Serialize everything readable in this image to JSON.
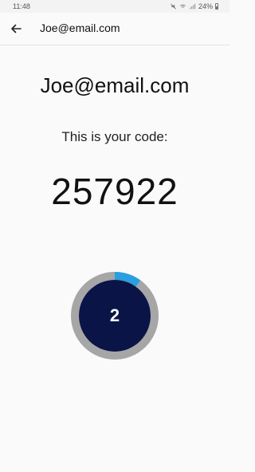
{
  "status_bar": {
    "time": "11:48",
    "battery": "24%"
  },
  "app_bar": {
    "title": "Joe@email.com"
  },
  "main": {
    "account": "Joe@email.com",
    "caption": "This is your code:",
    "code": "257922"
  },
  "timer": {
    "seconds_left": "2",
    "progress_fraction": 0.1,
    "colors": {
      "track": "#a6a6a6",
      "progress": "#2a9fe0",
      "center": "#0b1446",
      "text": "#ffffff"
    }
  }
}
